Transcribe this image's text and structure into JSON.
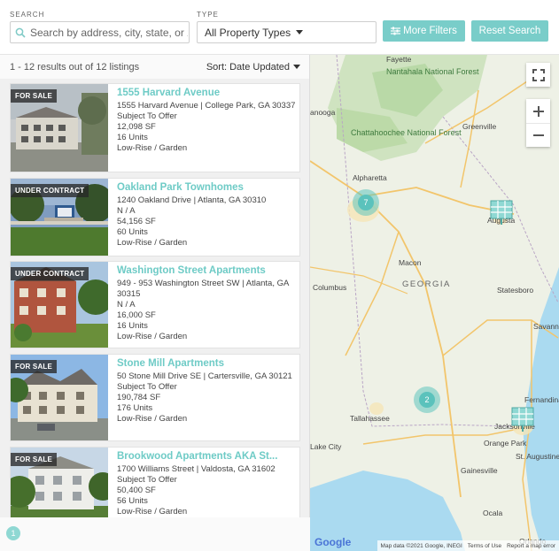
{
  "filters": {
    "search_label": "SEARCH",
    "search_placeholder": "Search by address, city, state, or z",
    "type_label": "TYPE",
    "type_value": "All Property Types",
    "more_filters_label": "More Filters",
    "reset_label": "Reset Search"
  },
  "results": {
    "count_text": "1 - 12 results out of 12 listings",
    "sort_label": "Sort: Date Updated",
    "listings": [
      {
        "badge": "FOR SALE",
        "name": "1555 Harvard Avenue",
        "address": "1555 Harvard Avenue | College Park, GA 30337",
        "offer": "Subject To Offer",
        "sf": "12,098 SF",
        "units": "16 Units",
        "type": "Low-Rise / Garden"
      },
      {
        "badge": "UNDER CONTRACT",
        "name": "Oakland Park Townhomes",
        "address": "1240 Oakland Drive | Atlanta, GA 30310",
        "offer": "N / A",
        "sf": "54,156 SF",
        "units": "60 Units",
        "type": "Low-Rise / Garden"
      },
      {
        "badge": "UNDER CONTRACT",
        "name": "Washington Street Apartments",
        "address": "949 - 953 Washington Street SW | Atlanta, GA 30315",
        "offer": "N / A",
        "sf": "16,000 SF",
        "units": "16 Units",
        "type": "Low-Rise / Garden"
      },
      {
        "badge": "FOR SALE",
        "name": "Stone Mill Apartments",
        "address": "50 Stone Mill Drive SE | Cartersville, GA 30121",
        "offer": "Subject To Offer",
        "sf": "190,784 SF",
        "units": "176 Units",
        "type": "Low-Rise / Garden"
      },
      {
        "badge": "FOR SALE",
        "name": "Brookwood Apartments AKA St...",
        "address": "1700 Williams Street | Valdosta, GA 31602",
        "offer": "Subject To Offer",
        "sf": "50,400 SF",
        "units": "56 Units",
        "type": "Low-Rise / Garden"
      }
    ],
    "page": "1"
  },
  "map": {
    "clusters": [
      "7",
      "2"
    ],
    "labels": {
      "nantahala": "Nantahala National Forest",
      "chattahoochee": "Chattahoochee National Forest",
      "chattanooga": "anooga",
      "greenville": "Greenville",
      "alpharetta": "Alpharetta",
      "augusta": "Augusta",
      "macon": "Macon",
      "georgia": "GEORGIA",
      "columbus": "Columbus",
      "statesboro": "Statesboro",
      "savannah": "Savann",
      "tallahassee": "Tallahassee",
      "jacksonville": "Jacksonville",
      "fernandina": "Fernandina Beach",
      "st_augustine": "St. Augustine",
      "gainesville": "Gainesville",
      "ocala": "Ocala",
      "orange_park": "Orange Park",
      "lake_city": "Lake City",
      "fayetteville": "Fayette",
      "orlando": "Orlando"
    },
    "google": "Google",
    "attribution": "Map data ©2021 Google, INEGI",
    "terms": "Terms of Use",
    "report": "Report a map error"
  },
  "colors": {
    "accent": "#79cdc9",
    "title": "#6ecbc6"
  }
}
